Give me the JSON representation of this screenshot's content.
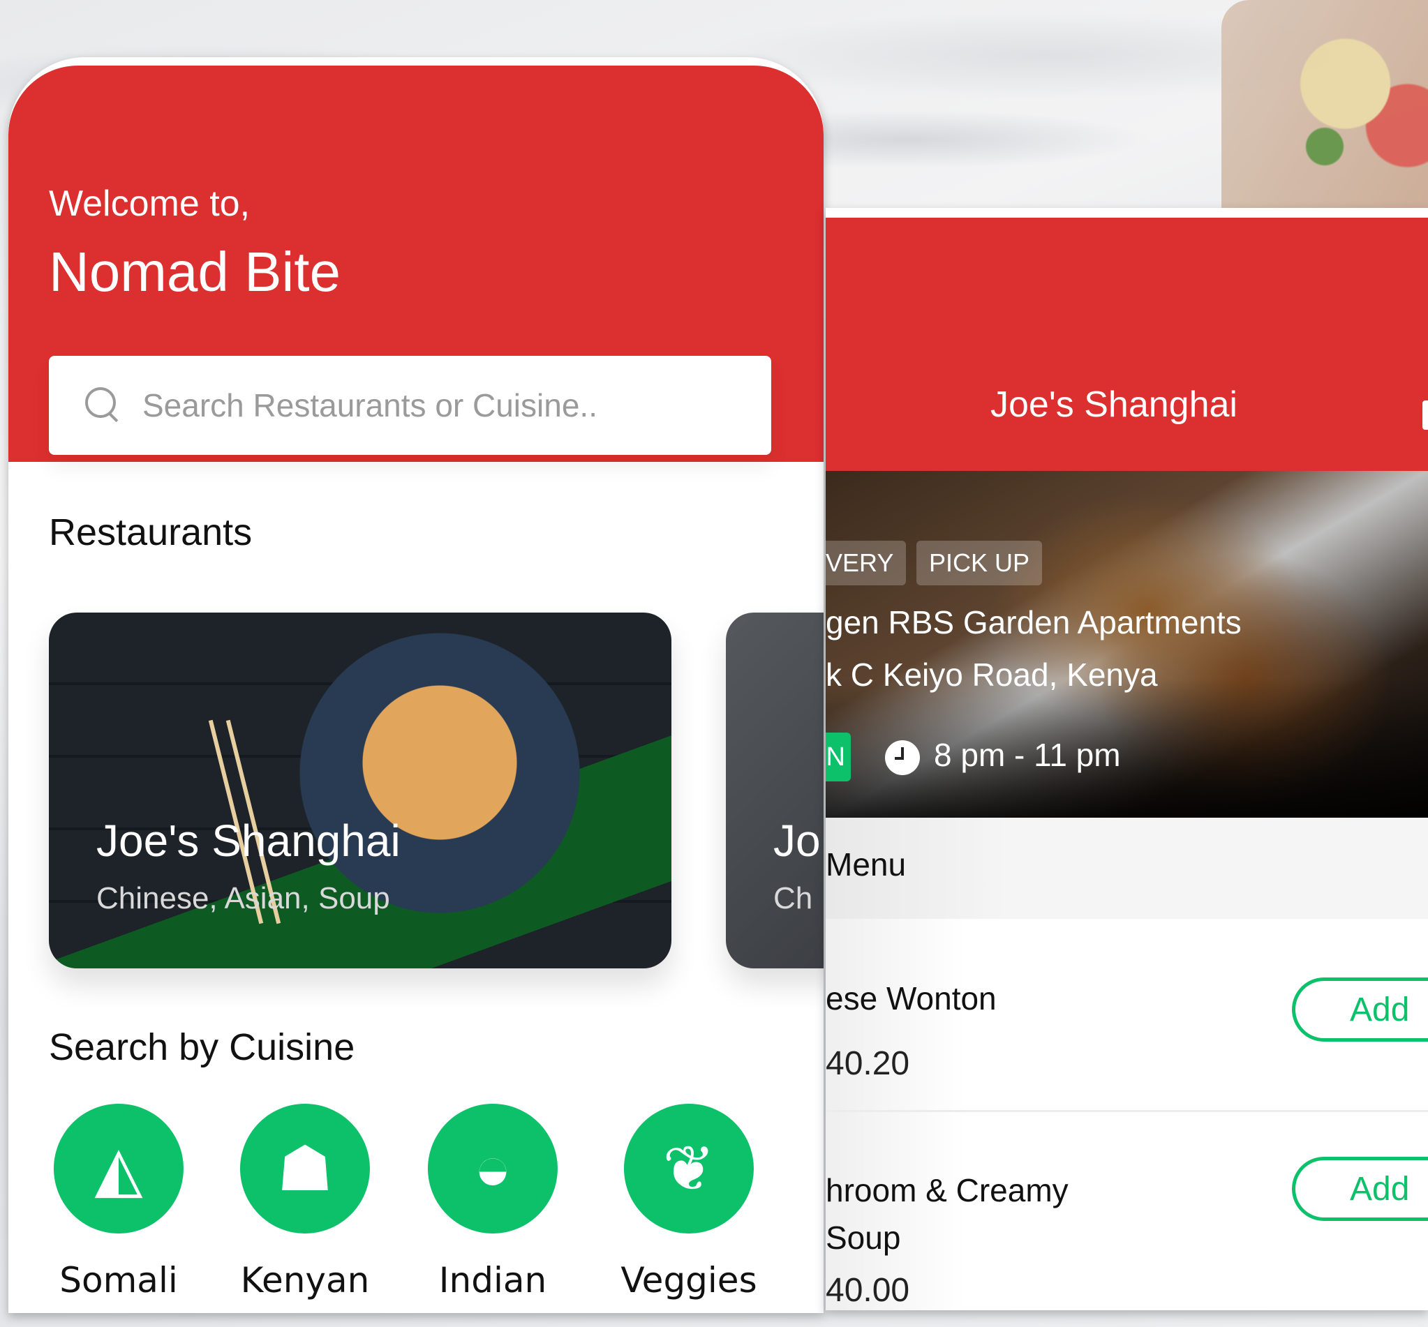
{
  "colors": {
    "brand_red": "#dc2f2f",
    "accent_green": "#0dc06a"
  },
  "home": {
    "welcome": "Welcome to,",
    "app_name": "Nomad Bite",
    "search": {
      "placeholder": "Search Restaurants or Cuisine..",
      "value": "",
      "icon": "search-icon"
    },
    "restaurants_title": "Restaurants",
    "restaurants": [
      {
        "name": "Joe's Shanghai",
        "tags": "Chinese, Asian, Soup"
      },
      {
        "name": "Jo",
        "tags": "Ch"
      }
    ],
    "cuisine_title": "Search by Cuisine",
    "cuisines": [
      {
        "label": "Somali",
        "icon": "samosa-icon",
        "glyph": "◭"
      },
      {
        "label": "Kenyan",
        "icon": "ugali-bowl-icon",
        "glyph": "☗"
      },
      {
        "label": "Indian",
        "icon": "curry-bowl-icon",
        "glyph": "◒"
      },
      {
        "label": "Veggies",
        "icon": "veggie-bowl-icon",
        "glyph": "❦"
      }
    ]
  },
  "restaurant": {
    "title": "Joe's Shanghai",
    "service_tags": [
      "VERY",
      "PICK UP"
    ],
    "address_line1": "gen RBS Garden Apartments",
    "address_line2": "k C Keiyo Road, Kenya",
    "status_badge": "N",
    "hours": "8 pm - 11 pm",
    "menu_title": "Menu",
    "menu_items": [
      {
        "name_lines": [
          "ese Wonton"
        ],
        "price": "40.20",
        "add_label": "Add"
      },
      {
        "name_lines": [
          "hroom & Creamy",
          " Soup"
        ],
        "price": "40.00",
        "add_label": "Add"
      }
    ]
  }
}
